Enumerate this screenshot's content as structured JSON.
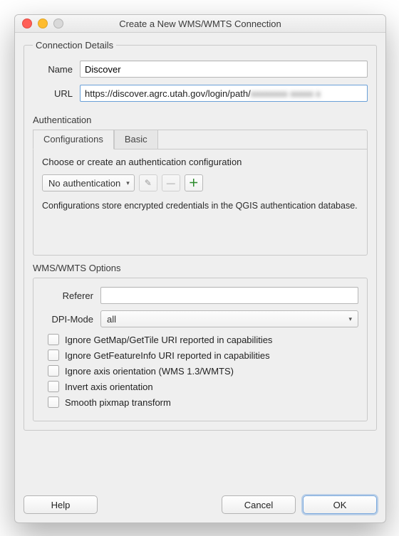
{
  "window": {
    "title": "Create a New WMS/WMTS Connection"
  },
  "connection": {
    "legend": "Connection Details",
    "name_label": "Name",
    "name_value": "Discover",
    "url_label": "URL",
    "url_visible": "https://discover.agrc.utah.gov/login/path/",
    "url_hidden": "xxxxxxxx xxxxx x"
  },
  "auth": {
    "legend": "Authentication",
    "tabs": {
      "configurations": "Configurations",
      "basic": "Basic"
    },
    "choose_line": "Choose or create an authentication configuration",
    "combo_value": "No authentication",
    "edit_icon": "✎",
    "delete_icon": "—",
    "add_icon": "＋",
    "hint": "Configurations store encrypted credentials in the QGIS authentication database."
  },
  "options": {
    "legend": "WMS/WMTS Options",
    "referer_label": "Referer",
    "referer_value": "",
    "dpi_label": "DPI-Mode",
    "dpi_value": "all",
    "checks": {
      "ignore_getmap": "Ignore GetMap/GetTile URI reported in capabilities",
      "ignore_getfeature": "Ignore GetFeatureInfo URI reported in capabilities",
      "ignore_axis": "Ignore axis orientation (WMS 1.3/WMTS)",
      "invert_axis": "Invert axis orientation",
      "smooth": "Smooth pixmap transform"
    }
  },
  "footer": {
    "help": "Help",
    "cancel": "Cancel",
    "ok": "OK"
  }
}
